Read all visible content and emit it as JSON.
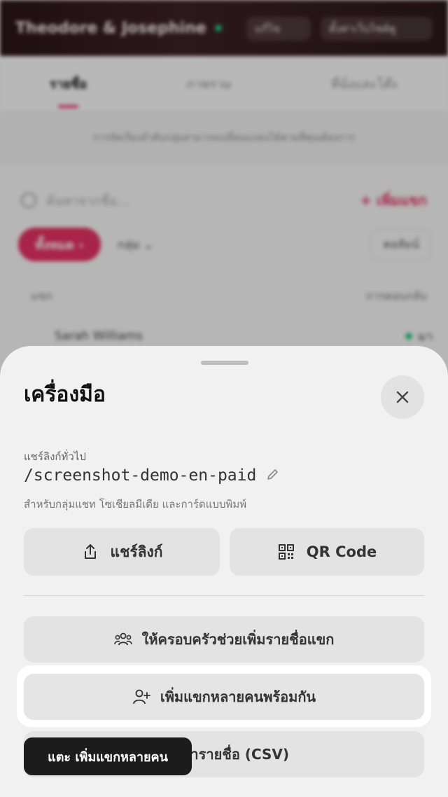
{
  "background": {
    "header_title": "Theodore & Josephine",
    "edit_label": "แก้ไข",
    "dashboard_label": "ตั้งค่าเว็บไซต์ดู",
    "tabs": [
      {
        "label": "รายชื่อ",
        "active": true
      },
      {
        "label": "ภาพรวม",
        "active": false
      },
      {
        "label": "ที่นั่งและโต๊ะ",
        "active": false
      }
    ],
    "info_text": "การจัดเรียงลำดับกลุ่มสามารถเปลี่ยนแปลงได้ตามที่คุณต้องการ",
    "search_placeholder": "ค้นหาจากชื่อ...",
    "add_label": "+ เพิ่มแขก",
    "filter_all": "ทั้งหมด ›",
    "filter_group": "กลุ่ม ⌄",
    "columns_label": "คอลัมน์",
    "table_headers": [
      "แขก",
      "การตอบกลับ"
    ],
    "sample_row": {
      "name": "Sarah Williams",
      "rsvp": "มา"
    }
  },
  "sheet": {
    "title": "เครื่องมือ",
    "close_icon": "close-icon",
    "link_label": "แชร์ลิงก์ทั่วไป",
    "link_slug": "/screenshot-demo-en-paid",
    "link_description": "สำหรับกลุ่มแชท โซเชียลมีเดีย และการ์ดแบบพิมพ์",
    "share_button": "แชร์ลิงก์",
    "qr_button": "QR Code",
    "family_button": "ให้ครอบครัวช่วยเพิ่มรายชื่อแขก",
    "bulk_button": "เพิ่มแขกหลายคนพร้อมกัน",
    "csv_button": "นำเข้ารายชื่อ (CSV)"
  },
  "toast": {
    "text": "แตะ เพิ่มแขกหลายคน"
  },
  "colors": {
    "accent": "#e03060",
    "sheet_bg": "#f2f1f1",
    "button_bg": "#e4e3e3",
    "toast_bg": "#1c1c1c"
  }
}
